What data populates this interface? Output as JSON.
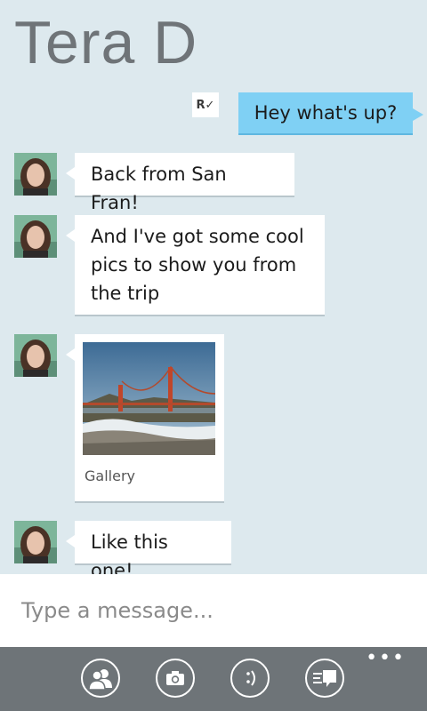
{
  "header": {
    "contact_name": "Tera D"
  },
  "conversation": {
    "receipt_label": "R✓",
    "sent": [
      {
        "text": "Hey what's up?"
      }
    ],
    "received": [
      {
        "text": "Back from San Fran!"
      },
      {
        "text": "And I've got some cool\npics to show you from\nthe trip"
      },
      {
        "photo_caption": "Gallery"
      },
      {
        "text": "Like this one!"
      }
    ]
  },
  "composer": {
    "placeholder": "Type a message..."
  },
  "appbar": {
    "buttons": [
      "contact-icon",
      "camera-icon",
      "emoticon-icon",
      "quick-replies-icon"
    ],
    "more_label": "•••"
  },
  "colors": {
    "background": "#dde9ee",
    "sent_bubble": "#7fd0f4",
    "received_bubble": "#ffffff",
    "appbar": "#6e7478",
    "title": "#6f7478"
  }
}
